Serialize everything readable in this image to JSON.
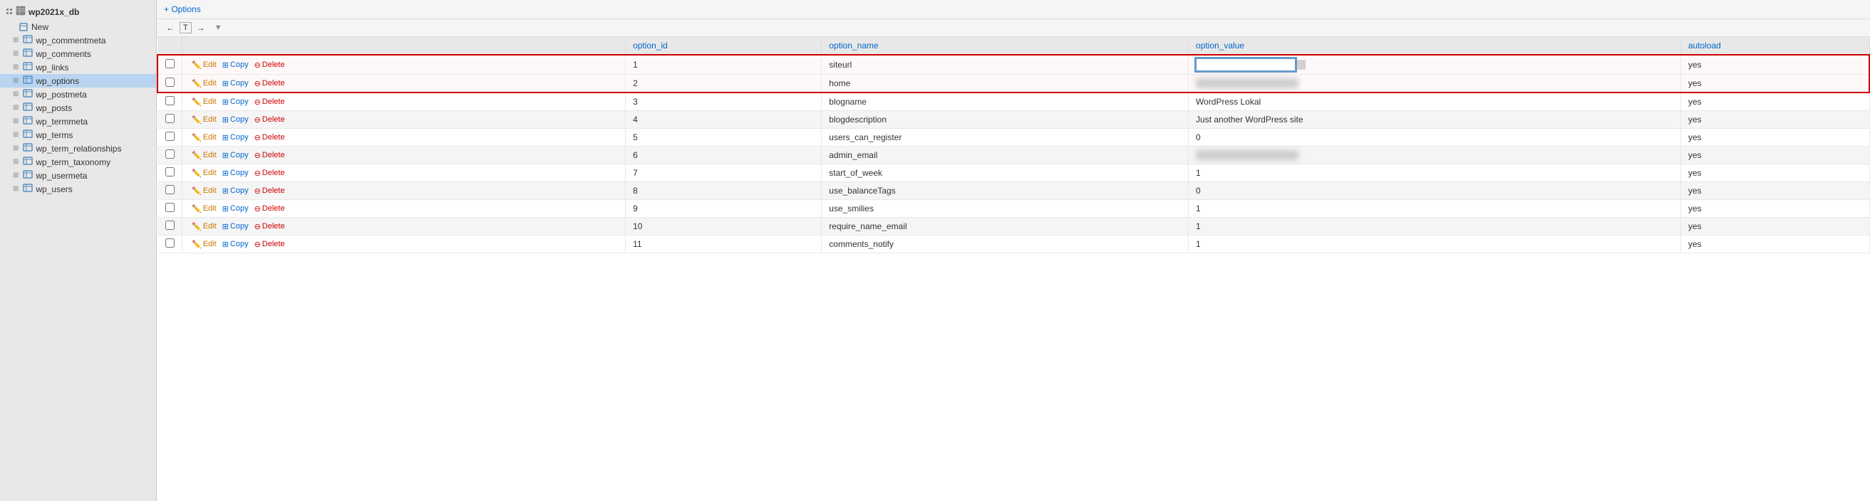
{
  "sidebar": {
    "db_name": "wp2021x_db",
    "new_label": "New",
    "tables": [
      {
        "name": "wp_commentmeta",
        "active": false
      },
      {
        "name": "wp_comments",
        "active": false
      },
      {
        "name": "wp_links",
        "active": false
      },
      {
        "name": "wp_options",
        "active": true
      },
      {
        "name": "wp_postmeta",
        "active": false
      },
      {
        "name": "wp_posts",
        "active": false
      },
      {
        "name": "wp_termmeta",
        "active": false
      },
      {
        "name": "wp_terms",
        "active": false
      },
      {
        "name": "wp_term_relationships",
        "active": false
      },
      {
        "name": "wp_term_taxonomy",
        "active": false
      },
      {
        "name": "wp_usermeta",
        "active": false
      },
      {
        "name": "wp_users",
        "active": false
      }
    ]
  },
  "toolbar": {
    "options_label": "+ Options"
  },
  "nav": {
    "left_arrow": "←",
    "table_icon": "T",
    "right_arrow": "→",
    "sort_arrow": "▼"
  },
  "columns": [
    {
      "key": "checkbox",
      "label": ""
    },
    {
      "key": "actions",
      "label": ""
    },
    {
      "key": "option_id",
      "label": "option_id"
    },
    {
      "key": "option_name",
      "label": "option_name"
    },
    {
      "key": "option_value",
      "label": "option_value"
    },
    {
      "key": "autoload",
      "label": "autoload"
    }
  ],
  "rows": [
    {
      "id": 1,
      "option_id": "1",
      "option_name": "siteurl",
      "option_value": "BLURRED",
      "option_value_editing": true,
      "autoload": "yes",
      "highlighted": true
    },
    {
      "id": 2,
      "option_id": "2",
      "option_name": "home",
      "option_value": "BLURRED",
      "option_value_editing": false,
      "autoload": "yes",
      "highlighted": true
    },
    {
      "id": 3,
      "option_id": "3",
      "option_name": "blogname",
      "option_value": "WordPress Lokal",
      "option_value_editing": false,
      "autoload": "yes",
      "highlighted": false
    },
    {
      "id": 4,
      "option_id": "4",
      "option_name": "blogdescription",
      "option_value": "Just another WordPress site",
      "option_value_editing": false,
      "autoload": "yes",
      "highlighted": false
    },
    {
      "id": 5,
      "option_id": "5",
      "option_name": "users_can_register",
      "option_value": "0",
      "option_value_editing": false,
      "autoload": "yes",
      "highlighted": false
    },
    {
      "id": 6,
      "option_id": "6",
      "option_name": "admin_email",
      "option_value": "BLURRED",
      "option_value_editing": false,
      "autoload": "yes",
      "highlighted": false
    },
    {
      "id": 7,
      "option_id": "7",
      "option_name": "start_of_week",
      "option_value": "1",
      "option_value_editing": false,
      "autoload": "yes",
      "highlighted": false
    },
    {
      "id": 8,
      "option_id": "8",
      "option_name": "use_balanceTags",
      "option_value": "0",
      "option_value_editing": false,
      "autoload": "yes",
      "highlighted": false
    },
    {
      "id": 9,
      "option_id": "9",
      "option_name": "use_smilies",
      "option_value": "1",
      "option_value_editing": false,
      "autoload": "yes",
      "highlighted": false
    },
    {
      "id": 10,
      "option_id": "10",
      "option_name": "require_name_email",
      "option_value": "1",
      "option_value_editing": false,
      "autoload": "yes",
      "highlighted": false
    },
    {
      "id": 11,
      "option_id": "11",
      "option_name": "comments_notify",
      "option_value": "1",
      "option_value_editing": false,
      "autoload": "yes",
      "highlighted": false
    }
  ],
  "labels": {
    "edit": "Edit",
    "copy": "Copy",
    "delete": "Delete"
  }
}
